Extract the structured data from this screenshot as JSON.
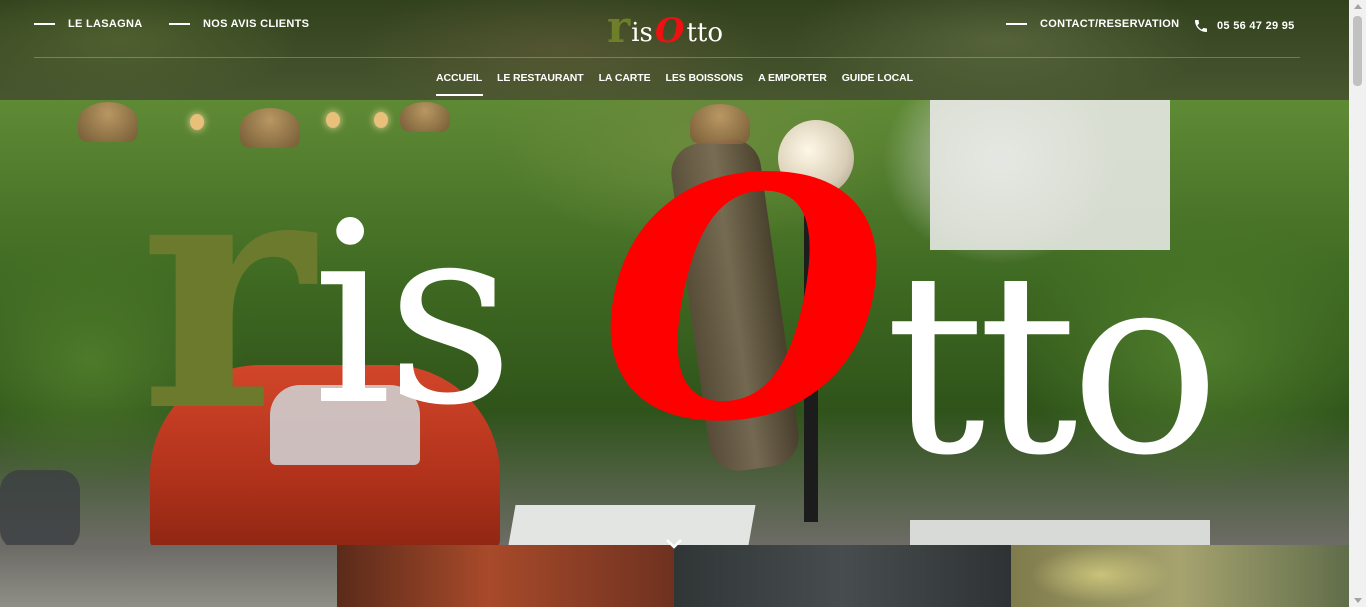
{
  "header": {
    "left_links": [
      {
        "label": "LE LASAGNA"
      },
      {
        "label": "NOS AVIS CLIENTS"
      }
    ],
    "right_links": [
      {
        "label": "CONTACT/RESERVATION"
      },
      {
        "label": "05 56 47 29 95",
        "icon": "phone-icon"
      }
    ],
    "logo": {
      "r": "r",
      "is": "is",
      "o": "O",
      "tto": "tto"
    }
  },
  "nav": {
    "items": [
      {
        "label": "ACCUEIL",
        "active": true
      },
      {
        "label": "LE RESTAURANT"
      },
      {
        "label": "LA CARTE"
      },
      {
        "label": "LES BOISSONS"
      },
      {
        "label": "A EMPORTER"
      },
      {
        "label": "GUIDE LOCAL"
      }
    ]
  },
  "hero": {
    "logo": {
      "r": "r",
      "is": "is",
      "o": "O",
      "tto": "tto"
    },
    "scroll_icon": "chevron-down-icon"
  },
  "colors": {
    "logo_green": "#6b7a2c",
    "logo_red": "#ff0000",
    "text_white": "#ffffff"
  }
}
